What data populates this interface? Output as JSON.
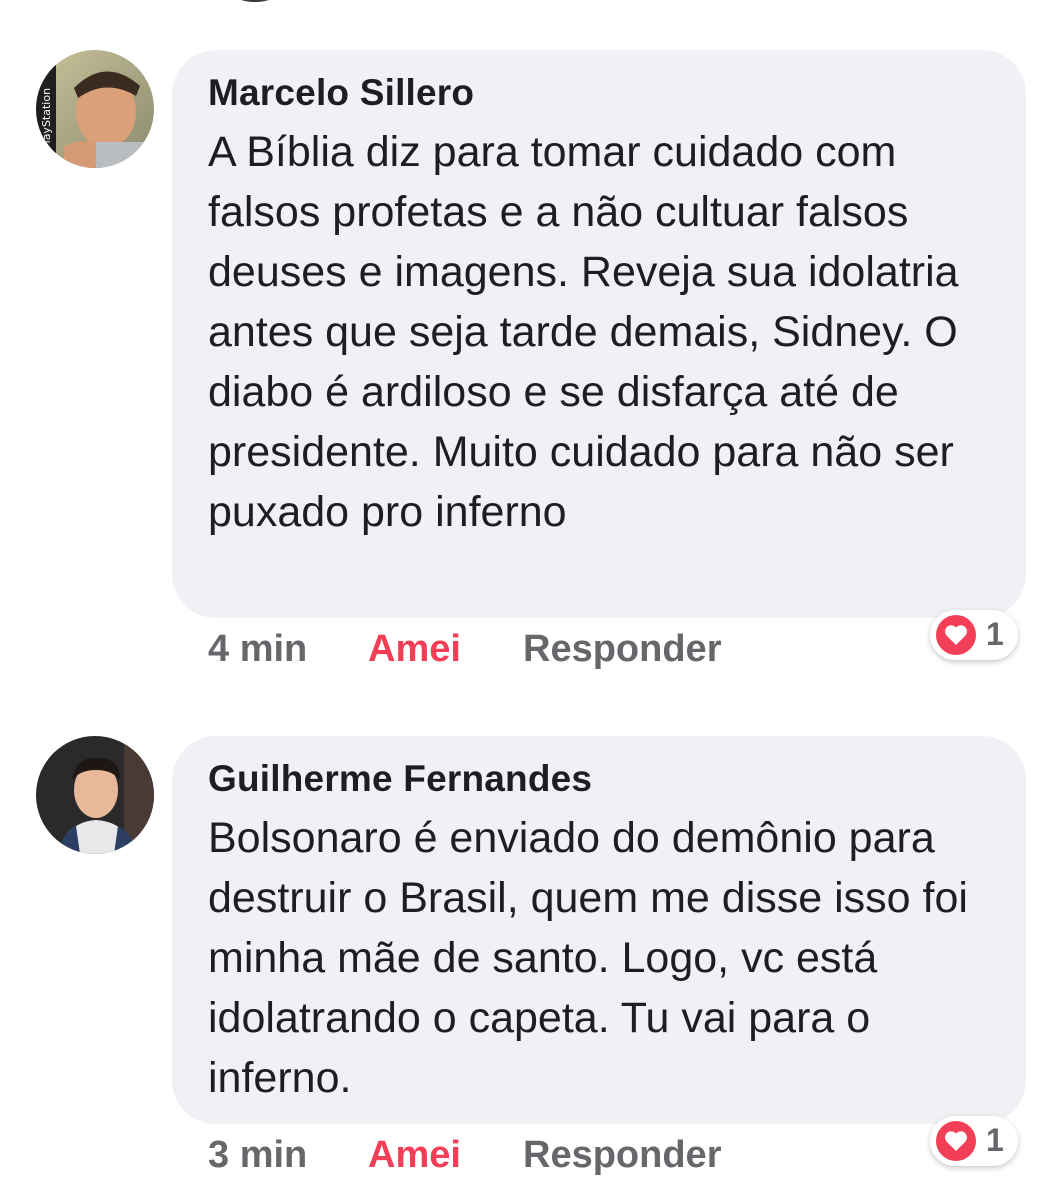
{
  "comments": [
    {
      "author": "Marcelo Sillero",
      "avatar_badge": "PlayStation",
      "text": "A Bíblia diz para tomar cuidado com falsos profetas e a não cultuar falsos deuses e imagens. Reveja sua idolatria antes que seja tarde demais, Sidney. O diabo é ardiloso e se disfarça até de presidente. Muito cuidado para não ser puxado pro inferno",
      "time": "4 min",
      "love_label": "Amei",
      "reply_label": "Responder",
      "reaction_icon": "heart-icon",
      "reaction_count": "1"
    },
    {
      "author": "Guilherme Fernandes",
      "text": "Bolsonaro é enviado do demônio para destruir o Brasil, quem me disse isso foi minha mãe de santo. Logo, vc está idolatrando o capeta. Tu vai para o inferno.",
      "time": "3 min",
      "love_label": "Amei",
      "reply_label": "Responder",
      "reaction_icon": "heart-icon",
      "reaction_count": "1"
    }
  ],
  "colors": {
    "bubble": "#f0f1f5",
    "love_red": "#f33e58",
    "meta_gray": "#65676b"
  }
}
